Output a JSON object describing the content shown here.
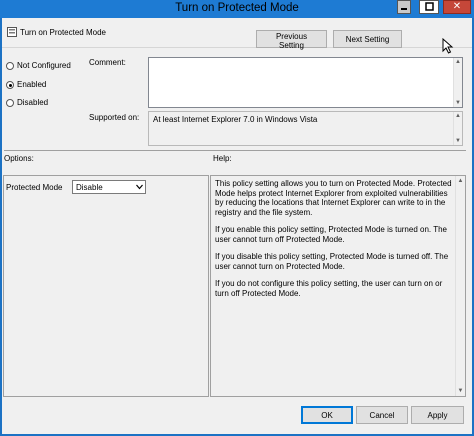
{
  "window": {
    "title": "Turn on Protected Mode",
    "close_glyph": "✕"
  },
  "header": {
    "setting_name": "Turn on Protected Mode",
    "previous_label": "Previous Setting",
    "next_label": "Next Setting"
  },
  "state": {
    "options": [
      {
        "label": "Not Configured",
        "selected": false
      },
      {
        "label": "Enabled",
        "selected": true
      },
      {
        "label": "Disabled",
        "selected": false
      }
    ]
  },
  "comment": {
    "label": "Comment:",
    "value": ""
  },
  "supported": {
    "label": "Supported on:",
    "value": "At least Internet Explorer 7.0 in Windows Vista"
  },
  "options_panel": {
    "label": "Options:",
    "protected_mode_label": "Protected Mode",
    "protected_mode_value": "Disable"
  },
  "help_panel": {
    "label": "Help:",
    "paragraphs": [
      "This policy setting allows you to turn on Protected Mode. Protected Mode helps protect Internet Explorer from exploited vulnerabilities by reducing the locations that Internet Explorer can write to in the registry and the file system.",
      "If you enable this policy setting, Protected Mode is turned on. The user cannot turn off Protected Mode.",
      "If you disable this policy setting, Protected Mode is turned off. The user cannot turn on Protected Mode.",
      "If you do not configure this policy setting, the user can turn on or turn off Protected Mode."
    ]
  },
  "footer": {
    "ok_label": "OK",
    "cancel_label": "Cancel",
    "apply_label": "Apply"
  },
  "icons": {
    "title_bar": [
      "minimize-icon",
      "maximize-icon",
      "close-icon"
    ],
    "setting": "policy-setting-icon",
    "scroll": [
      "scroll-up-icon",
      "scroll-down-icon"
    ],
    "dropdown": "chevron-down-icon"
  },
  "colors": {
    "title_bar": "#1e7bd3",
    "close_button": "#c54739",
    "dialog_bg": "#f0f0f0",
    "accent": "#0078d7"
  }
}
